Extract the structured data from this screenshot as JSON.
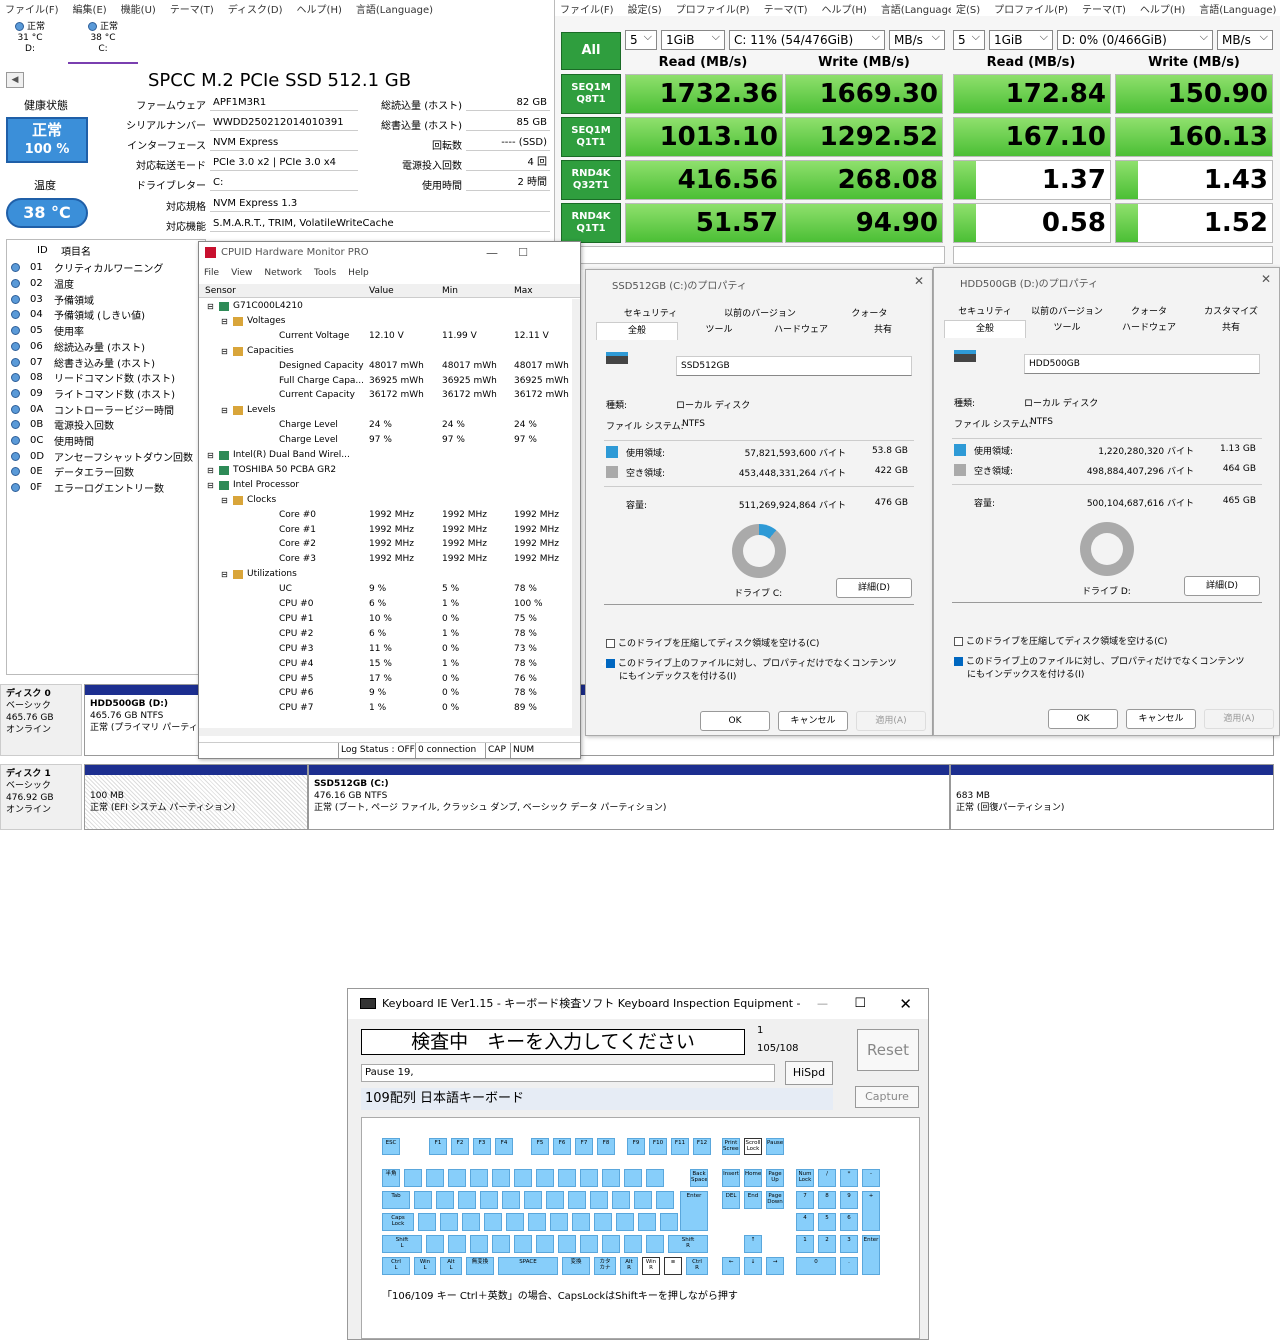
{
  "cdi": {
    "menu": [
      "ファイル(F)",
      "編集(E)",
      "機能(U)",
      "テーマ(T)",
      "ディスク(D)",
      "ヘルプ(H)",
      "言語(Language)"
    ],
    "drives": [
      {
        "status": "正常",
        "temp": "31 °C",
        "letter": "D:"
      },
      {
        "status": "正常",
        "temp": "38 °C",
        "letter": "C:"
      }
    ],
    "model": "SPCC M.2 PCIe SSD 512.1 GB",
    "health_label": "健康状態",
    "health_status": "正常",
    "health_pct": "100 %",
    "temp_label": "温度",
    "temp_value": "38 °C",
    "info_left": [
      {
        "label": "ファームウェア",
        "value": "APF1M3R1"
      },
      {
        "label": "シリアルナンバー",
        "value": "WWDD250212014010391"
      },
      {
        "label": "インターフェース",
        "value": "NVM Express"
      },
      {
        "label": "対応転送モード",
        "value": "PCIe 3.0 x2 | PCIe 3.0 x4"
      },
      {
        "label": "ドライブレター",
        "value": "C:"
      }
    ],
    "info_right": [
      {
        "label": "総読込量 (ホスト)",
        "value": "82 GB"
      },
      {
        "label": "総書込量 (ホスト)",
        "value": "85 GB"
      },
      {
        "label": "回転数",
        "value": "---- (SSD)"
      },
      {
        "label": "電源投入回数",
        "value": "4 回"
      },
      {
        "label": "使用時間",
        "value": "2 時間"
      }
    ],
    "standard_label": "対応規格",
    "standard_value": "NVM Express 1.3",
    "features_label": "対応機能",
    "features_value": "S.M.A.R.T., TRIM, VolatileWriteCache",
    "attr_head": {
      "id": "ID",
      "name": "項目名"
    },
    "attrs": [
      {
        "id": "01",
        "name": "クリティカルワーニング"
      },
      {
        "id": "02",
        "name": "温度"
      },
      {
        "id": "03",
        "name": "予備領域"
      },
      {
        "id": "04",
        "name": "予備領域 (しきい値)"
      },
      {
        "id": "05",
        "name": "使用率"
      },
      {
        "id": "06",
        "name": "総読込み量 (ホスト)"
      },
      {
        "id": "07",
        "name": "総書き込み量 (ホスト)"
      },
      {
        "id": "08",
        "name": "リードコマンド数 (ホスト)"
      },
      {
        "id": "09",
        "name": "ライトコマンド数 (ホスト)"
      },
      {
        "id": "0A",
        "name": "コントローラービジー時間"
      },
      {
        "id": "0B",
        "name": "電源投入回数"
      },
      {
        "id": "0C",
        "name": "使用時間"
      },
      {
        "id": "0D",
        "name": "アンセーフシャットダウン回数"
      },
      {
        "id": "0E",
        "name": "データエラー回数"
      },
      {
        "id": "0F",
        "name": "エラーログエントリー数"
      }
    ]
  },
  "cdm": {
    "menu": [
      "ファイル(F)",
      "設定(S)",
      "プロファイル(P)",
      "テーマ(T)",
      "ヘルプ(H)",
      "言語(Language)"
    ],
    "all": "All",
    "count": "5",
    "size": "1GiB",
    "drive": "C: 11% (54/476GiB)",
    "unit": "MB/s",
    "read_hdr": "Read (MB/s)",
    "write_hdr": "Write (MB/s)",
    "tests": [
      {
        "l1": "SEQ1M",
        "l2": "Q8T1"
      },
      {
        "l1": "SEQ1M",
        "l2": "Q1T1"
      },
      {
        "l1": "RND4K",
        "l2": "Q32T1"
      },
      {
        "l1": "RND4K",
        "l2": "Q1T1"
      }
    ],
    "read": [
      "1732.36",
      "1013.10",
      "416.56",
      "51.57"
    ],
    "write": [
      "1669.30",
      "1292.52",
      "268.08",
      "94.90"
    ],
    "read_fill": [
      1,
      1,
      1,
      1
    ],
    "write_fill": [
      1,
      1,
      1,
      1
    ]
  },
  "cdm2": {
    "menu": [
      "定(S)",
      "プロファイル(P)",
      "テーマ(T)",
      "ヘルプ(H)",
      "言語(Language)"
    ],
    "count": "5",
    "size": "1GiB",
    "drive": "D: 0% (0/466GiB)",
    "unit": "MB/s",
    "read_hdr": "Read (MB/s)",
    "write_hdr": "Write (MB/s)",
    "read": [
      "172.84",
      "167.10",
      "1.37",
      "0.58"
    ],
    "write": [
      "150.90",
      "160.13",
      "1.43",
      "1.52"
    ],
    "read_fill": [
      1,
      1,
      0.02,
      0.02
    ],
    "write_fill": [
      1,
      1,
      0.02,
      0.02
    ]
  },
  "hwm": {
    "title": "CPUID Hardware Monitor PRO",
    "menu": [
      "File",
      "View",
      "Network",
      "Tools",
      "Help"
    ],
    "cols": [
      "Sensor",
      "Value",
      "Min",
      "Max"
    ],
    "rows": [
      {
        "lvl": 1,
        "name": "G71C000L4210",
        "v": "",
        "mn": "",
        "mx": ""
      },
      {
        "lvl": 2,
        "name": "Voltages",
        "v": "",
        "mn": "",
        "mx": ""
      },
      {
        "lvl": 3,
        "name": "Current Voltage",
        "v": "12.10 V",
        "mn": "11.99 V",
        "mx": "12.11 V"
      },
      {
        "lvl": 2,
        "name": "Capacities",
        "v": "",
        "mn": "",
        "mx": ""
      },
      {
        "lvl": 3,
        "name": "Designed Capacity",
        "v": "48017 mWh",
        "mn": "48017 mWh",
        "mx": "48017 mWh"
      },
      {
        "lvl": 3,
        "name": "Full Charge Capa...",
        "v": "36925 mWh",
        "mn": "36925 mWh",
        "mx": "36925 mWh"
      },
      {
        "lvl": 3,
        "name": "Current Capacity",
        "v": "36172 mWh",
        "mn": "36172 mWh",
        "mx": "36172 mWh"
      },
      {
        "lvl": 2,
        "name": "Levels",
        "v": "",
        "mn": "",
        "mx": ""
      },
      {
        "lvl": 3,
        "name": "Charge Level",
        "v": "24 %",
        "mn": "24 %",
        "mx": "24 %"
      },
      {
        "lvl": 3,
        "name": "Charge Level",
        "v": "97 %",
        "mn": "97 %",
        "mx": "97 %"
      },
      {
        "lvl": 1,
        "name": "Intel(R) Dual Band Wirel...",
        "v": "",
        "mn": "",
        "mx": ""
      },
      {
        "lvl": 1,
        "name": "TOSHIBA 50 PCBA GR2",
        "v": "",
        "mn": "",
        "mx": ""
      },
      {
        "lvl": 1,
        "name": "Intel Processor",
        "v": "",
        "mn": "",
        "mx": ""
      },
      {
        "lvl": 2,
        "name": "Clocks",
        "v": "",
        "mn": "",
        "mx": ""
      },
      {
        "lvl": 3,
        "name": "Core #0",
        "v": "1992 MHz",
        "mn": "1992 MHz",
        "mx": "1992 MHz"
      },
      {
        "lvl": 3,
        "name": "Core #1",
        "v": "1992 MHz",
        "mn": "1992 MHz",
        "mx": "1992 MHz"
      },
      {
        "lvl": 3,
        "name": "Core #2",
        "v": "1992 MHz",
        "mn": "1992 MHz",
        "mx": "1992 MHz"
      },
      {
        "lvl": 3,
        "name": "Core #3",
        "v": "1992 MHz",
        "mn": "1992 MHz",
        "mx": "1992 MHz"
      },
      {
        "lvl": 2,
        "name": "Utilizations",
        "v": "",
        "mn": "",
        "mx": ""
      },
      {
        "lvl": 3,
        "name": "UC",
        "v": "9 %",
        "mn": "5 %",
        "mx": "78 %"
      },
      {
        "lvl": 3,
        "name": "CPU #0",
        "v": "6 %",
        "mn": "1 %",
        "mx": "100 %"
      },
      {
        "lvl": 3,
        "name": "CPU #1",
        "v": "10 %",
        "mn": "0 %",
        "mx": "75 %"
      },
      {
        "lvl": 3,
        "name": "CPU #2",
        "v": "6 %",
        "mn": "1 %",
        "mx": "78 %"
      },
      {
        "lvl": 3,
        "name": "CPU #3",
        "v": "11 %",
        "mn": "0 %",
        "mx": "73 %"
      },
      {
        "lvl": 3,
        "name": "CPU #4",
        "v": "15 %",
        "mn": "1 %",
        "mx": "78 %"
      },
      {
        "lvl": 3,
        "name": "CPU #5",
        "v": "17 %",
        "mn": "0 %",
        "mx": "76 %"
      },
      {
        "lvl": 3,
        "name": "CPU #6",
        "v": "9 %",
        "mn": "0 %",
        "mx": "78 %"
      },
      {
        "lvl": 3,
        "name": "CPU #7",
        "v": "1 %",
        "mn": "0 %",
        "mx": "89 %"
      }
    ],
    "status": [
      "Log Status : OFF",
      "0 connection",
      "CAP",
      "NUM"
    ]
  },
  "prop_c": {
    "title": "SSD512GB (C:)のプロパティ",
    "tabs_top": [
      "セキュリティ",
      "以前のバージョン",
      "クォータ"
    ],
    "tabs_bottom": [
      "全般",
      "ツール",
      "ハードウェア",
      "共有"
    ],
    "name": "SSD512GB",
    "type_label": "種類:",
    "type": "ローカル ディスク",
    "fs_label": "ファイル システム:",
    "fs": "NTFS",
    "used_label": "使用領域:",
    "used_bytes": "57,821,593,600 バイト",
    "used_gb": "53.8 GB",
    "free_label": "空き領域:",
    "free_bytes": "453,448,331,264 バイト",
    "free_gb": "422 GB",
    "cap_label": "容量:",
    "cap_bytes": "511,269,924,864 バイト",
    "cap_gb": "476 GB",
    "drive": "ドライブ C:",
    "detail": "詳細(D)",
    "used_frac": 0.11,
    "compress": "このドライブを圧縮してディスク領域を空ける(C)",
    "index": "このドライブ上のファイルに対し、プロパティだけでなくコンテンツにもインデックスを付ける(I)",
    "ok": "OK",
    "cancel": "キャンセル",
    "apply": "適用(A)",
    "used_color": "#2e9ad6"
  },
  "prop_d": {
    "title": "HDD500GB (D:)のプロパティ",
    "tabs_top": [
      "セキュリティ",
      "以前のバージョン",
      "クォータ",
      "カスタマイズ"
    ],
    "tabs_bottom": [
      "全般",
      "ツール",
      "ハードウェア",
      "共有"
    ],
    "name": "HDD500GB",
    "type_label": "種類:",
    "type": "ローカル ディスク",
    "fs_label": "ファイル システム:",
    "fs": "NTFS",
    "used_label": "使用領域:",
    "used_bytes": "1,220,280,320 バイト",
    "used_gb": "1.13 GB",
    "free_label": "空き領域:",
    "free_bytes": "498,884,407,296 バイト",
    "free_gb": "464 GB",
    "cap_label": "容量:",
    "cap_bytes": "500,104,687,616 バイト",
    "cap_gb": "465 GB",
    "drive": "ドライブ D:",
    "detail": "詳細(D)",
    "used_frac": 0.0,
    "compress": "このドライブを圧縮してディスク領域を空ける(C)",
    "index": "このドライブ上のファイルに対し、プロパティだけでなくコンテンツにもインデックスを付ける(I)",
    "ok": "OK",
    "cancel": "キャンセル",
    "apply": "適用(A)",
    "used_color": "#2e9ad6"
  },
  "dm": {
    "disk0": {
      "name": "ディスク 0",
      "type": "ベーシック",
      "size": "465.76 GB",
      "state": "オンライン"
    },
    "disk0_part": {
      "title": "HDD500GB (D:)",
      "size": "465.76 GB NTFS",
      "status": "正常 (プライマリ パーティション)"
    },
    "disk1": {
      "name": "ディスク 1",
      "type": "ベーシック",
      "size": "476.92 GB",
      "state": "オンライン"
    },
    "disk1_parts": [
      {
        "title": "",
        "size": "100 MB",
        "status": "正常 (EFI システム パーティション)"
      },
      {
        "title": "SSD512GB (C:)",
        "size": "476.16 GB NTFS",
        "status": "正常 (ブート, ページ ファイル, クラッシュ ダンプ, ベーシック データ パーティション)"
      },
      {
        "title": "",
        "size": "683 MB",
        "status": "正常 (回復パーティション)"
      }
    ]
  },
  "kie": {
    "title": "Keyboard IE Ver1.15 - キーボード検査ソフト Keyboard Inspection Equipment -",
    "prompt": "検査中　キーを入力してください",
    "count1": "1",
    "count2": "105/108",
    "log": "Pause 19,",
    "layout": "109配列 日本語キーボード",
    "reset": "Reset",
    "hispd": "HiSpd",
    "capture": "Capture",
    "note": "「106/109 キー Ctrl＋英数」の場合、CapsLockはShiftキーを押しながら押す"
  }
}
